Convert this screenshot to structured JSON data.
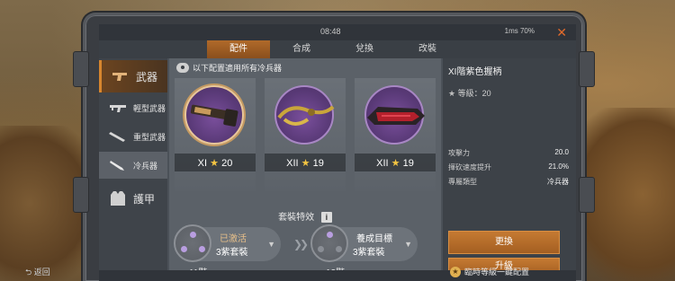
{
  "status": {
    "time": "08:48",
    "network": "1ms 70%"
  },
  "tabs": [
    {
      "label": "配件"
    },
    {
      "label": "合成"
    },
    {
      "label": "兌換"
    },
    {
      "label": "改裝"
    }
  ],
  "nav": {
    "weapon": "武器",
    "light": "輕型武器",
    "heavy": "重型武器",
    "melee": "冷兵器",
    "armor": "護甲"
  },
  "notice": "以下配置適用所有冷兵器",
  "cards": [
    {
      "tier": "XI",
      "stars": "20"
    },
    {
      "tier": "XII",
      "stars": "19"
    },
    {
      "tier": "XII",
      "stars": "19"
    }
  ],
  "set_title": "套裝特效",
  "set_current": {
    "status": "已激活",
    "name": "3紫套裝",
    "level": "11階"
  },
  "set_target": {
    "status": "養成目標",
    "name": "3紫套裝",
    "level": "12階"
  },
  "detail": {
    "title": "XI階紫色握柄",
    "level": "等級：20",
    "stats": [
      {
        "label": "攻擊力",
        "value": "20.0"
      },
      {
        "label": "揮砍速度提升",
        "value": "21.0%"
      },
      {
        "label": "專屬類型",
        "value": "冷兵器"
      }
    ],
    "replace": "更換",
    "upgrade": "升級"
  },
  "footer": {
    "back": "返回",
    "onekey": "臨時等級一鍵配置"
  },
  "colors": {
    "accent": "#b06a2a",
    "purple": "#5a3a78",
    "star": "#f5c542"
  }
}
